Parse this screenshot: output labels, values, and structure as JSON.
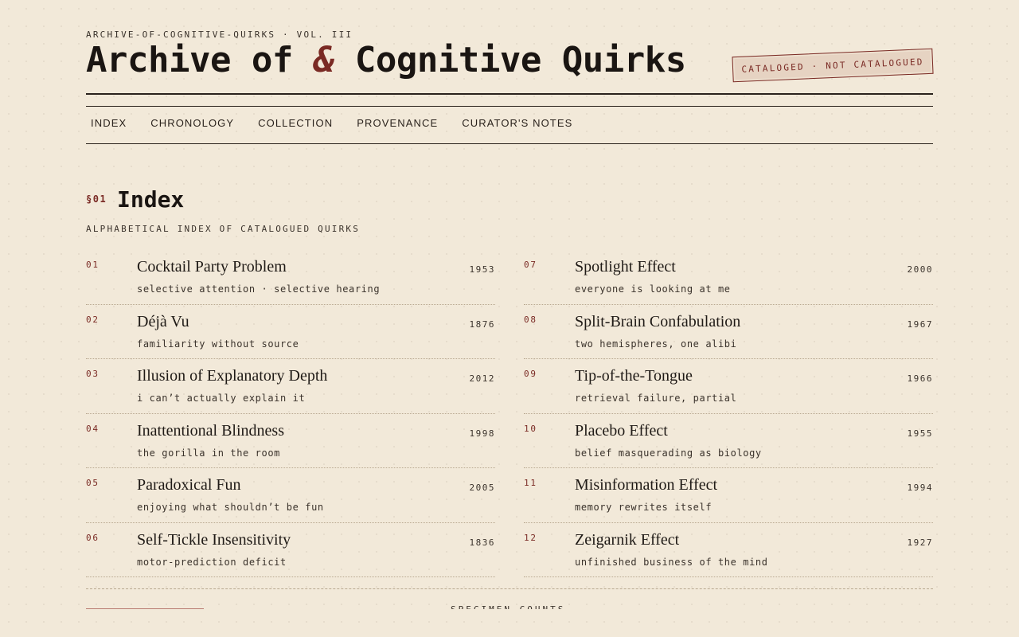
{
  "header": {
    "kicker": "ARCHIVE-OF-COGNITIVE-QUIRKS · VOL. III",
    "title_pre": "Archive of ",
    "title_amp": "&",
    "title_post": " Cognitive Quirks",
    "stamp": "CATALOGED · NOT CATALOGUED"
  },
  "nav": [
    "INDEX",
    "CHRONOLOGY",
    "COLLECTION",
    "PROVENANCE",
    "CURATOR'S NOTES"
  ],
  "section": {
    "number": "§01",
    "title": "Index",
    "subtitle": "ALPHABETICAL INDEX OF CATALOGUED QUIRKS"
  },
  "entries": [
    {
      "num": "01",
      "name": "Cocktail Party Problem",
      "year": "1953",
      "desc": "selective attention · selective hearing"
    },
    {
      "num": "02",
      "name": "Déjà Vu",
      "year": "1876",
      "desc": "familiarity without source"
    },
    {
      "num": "03",
      "name": "Illusion of Explanatory Depth",
      "year": "2012",
      "desc": "i can’t actually explain it"
    },
    {
      "num": "04",
      "name": "Inattentional Blindness",
      "year": "1998",
      "desc": "the gorilla in the room"
    },
    {
      "num": "05",
      "name": "Paradoxical Fun",
      "year": "2005",
      "desc": "enjoying what shouldn’t be fun"
    },
    {
      "num": "06",
      "name": "Self-Tickle Insensitivity",
      "year": "1836",
      "desc": "motor-prediction deficit"
    },
    {
      "num": "07",
      "name": "Spotlight Effect",
      "year": "2000",
      "desc": "everyone is looking at me"
    },
    {
      "num": "08",
      "name": "Split-Brain Confabulation",
      "year": "1967",
      "desc": "two hemispheres, one alibi"
    },
    {
      "num": "09",
      "name": "Tip-of-the-Tongue",
      "year": "1966",
      "desc": "retrieval failure, partial"
    },
    {
      "num": "10",
      "name": "Placebo Effect",
      "year": "1955",
      "desc": "belief masquerading as biology"
    },
    {
      "num": "11",
      "name": "Misinformation Effect",
      "year": "1994",
      "desc": "memory rewrites itself"
    },
    {
      "num": "12",
      "name": "Zeigarnik Effect",
      "year": "1927",
      "desc": "unfinished business of the mind"
    }
  ],
  "footer": {
    "label": "SPECIMEN COUNTS"
  },
  "colors": {
    "background": "#f2e9d9",
    "accent": "#7a2a24",
    "ink": "#1f1a16"
  }
}
